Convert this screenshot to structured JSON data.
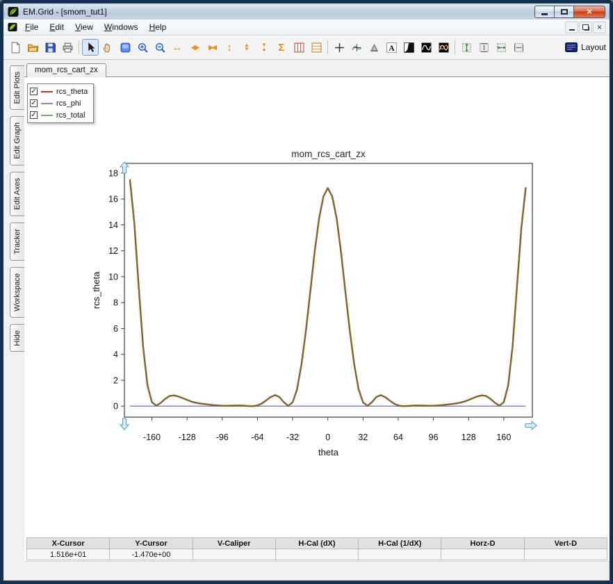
{
  "window": {
    "title": "EM.Grid - [smom_tut1]"
  },
  "menu": {
    "items": [
      "File",
      "Edit",
      "View",
      "Windows",
      "Help"
    ]
  },
  "toolbar": {
    "layout_label": "Layout"
  },
  "sidebar": {
    "tabs": [
      "Edit Plots",
      "Edit Graph",
      "Edit Axes",
      "Tracker",
      "Workspace",
      "Hide"
    ]
  },
  "doc_tab": "mom_rcs_cart_zx",
  "legend": {
    "items": [
      {
        "label": "rcs_theta",
        "color": "#c23322",
        "checked": true
      },
      {
        "label": "rcs_phi",
        "color": "#8787c9",
        "checked": true
      },
      {
        "label": "rcs_total",
        "color": "#76aa6e",
        "checked": true
      }
    ]
  },
  "readout": {
    "headers": [
      "X-Cursor",
      "Y-Cursor",
      "V-Caliper",
      "H-Cal (dX)",
      "H-Cal (1/dX)",
      "Horz-D",
      "Vert-D"
    ],
    "values": [
      "1.516e+01",
      "-1.470e+00",
      "",
      "",
      "",
      "",
      ""
    ]
  },
  "chart_data": {
    "type": "line",
    "title": "mom_rcs_cart_zx",
    "xlabel": "theta",
    "ylabel": "rcs_theta",
    "x_range": [
      -185,
      186
    ],
    "y_range": [
      -0.85,
      18.75
    ],
    "x_ticks": [
      -160,
      -128,
      -96,
      -64,
      -32,
      0,
      32,
      64,
      96,
      128,
      160
    ],
    "y_ticks": [
      0,
      2,
      4,
      6,
      8,
      10,
      12,
      14,
      16,
      18
    ],
    "x_start": -180,
    "x_step": 4,
    "grid": false,
    "legend_position": "top-left",
    "series": [
      {
        "name": "rcs_phi",
        "color": "#7a7ec2",
        "width": 1.4,
        "flat": 0
      },
      {
        "name": "rcs_theta",
        "color": "#b03a1e",
        "width": 2.4,
        "y": [
          17.5,
          14.2,
          9.2,
          4.6,
          1.6,
          0.3,
          0.04,
          0.25,
          0.55,
          0.78,
          0.83,
          0.75,
          0.62,
          0.48,
          0.35,
          0.26,
          0.2,
          0.16,
          0.12,
          0.08,
          0.05,
          0.03,
          0.03,
          0.04,
          0.05,
          0.05,
          0.03,
          0.01,
          0.0,
          0.05,
          0.2,
          0.45,
          0.7,
          0.85,
          0.7,
          0.3,
          0.02,
          0.3,
          1.3,
          3.2,
          5.8,
          8.8,
          11.9,
          14.5,
          16.2,
          16.85,
          16.2,
          14.5,
          11.9,
          8.8,
          5.8,
          3.2,
          1.3,
          0.3,
          0.02,
          0.3,
          0.7,
          0.85,
          0.7,
          0.45,
          0.2,
          0.05,
          0.0,
          0.01,
          0.03,
          0.05,
          0.05,
          0.04,
          0.03,
          0.03,
          0.05,
          0.08,
          0.12,
          0.16,
          0.2,
          0.26,
          0.35,
          0.48,
          0.62,
          0.75,
          0.83,
          0.78,
          0.55,
          0.25,
          0.04,
          0.3,
          1.6,
          4.6,
          9.2,
          13.8,
          16.9
        ]
      },
      {
        "name": "rcs_total",
        "color": "#4e8a30",
        "width": 1.2,
        "same_as": "rcs_theta"
      }
    ]
  }
}
